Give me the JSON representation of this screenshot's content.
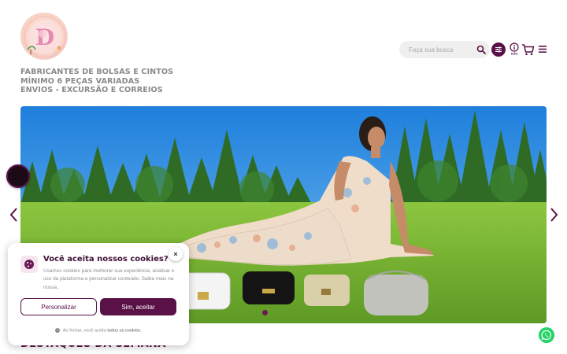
{
  "header": {
    "logo_alt": "D",
    "tagline": [
      "FABRICANTES DE BOLSAS E CINTOS",
      "MÍNIMO 6 PEÇAS VARIADAS",
      "ENVIOS - EXCURSÃO E CORREIOS"
    ],
    "search": {
      "placeholder": "Faça sua busca"
    },
    "info_label": "info"
  },
  "banner": {
    "carousel_active_index": 1
  },
  "section": {
    "title": "DESTAQUES DA SEMANA"
  },
  "cookie": {
    "title": "Você aceita nossos cookies?",
    "text": "Usamos cookies para melhorar sua experiência, analisar o uso da plataforma e personalizar conteúdo. Saiba mais na nossa .",
    "customize_label": "Personalizar",
    "accept_label": "Sim, aceitar",
    "close_label": "×",
    "footer_prefix": "Ao fechar, você aceita",
    "footer_bold": "todos os cookies."
  },
  "colors": {
    "brand": "#5a1147",
    "whatsapp": "#25d366",
    "grass": "#7ab83a",
    "sky": "#2e8de0"
  }
}
